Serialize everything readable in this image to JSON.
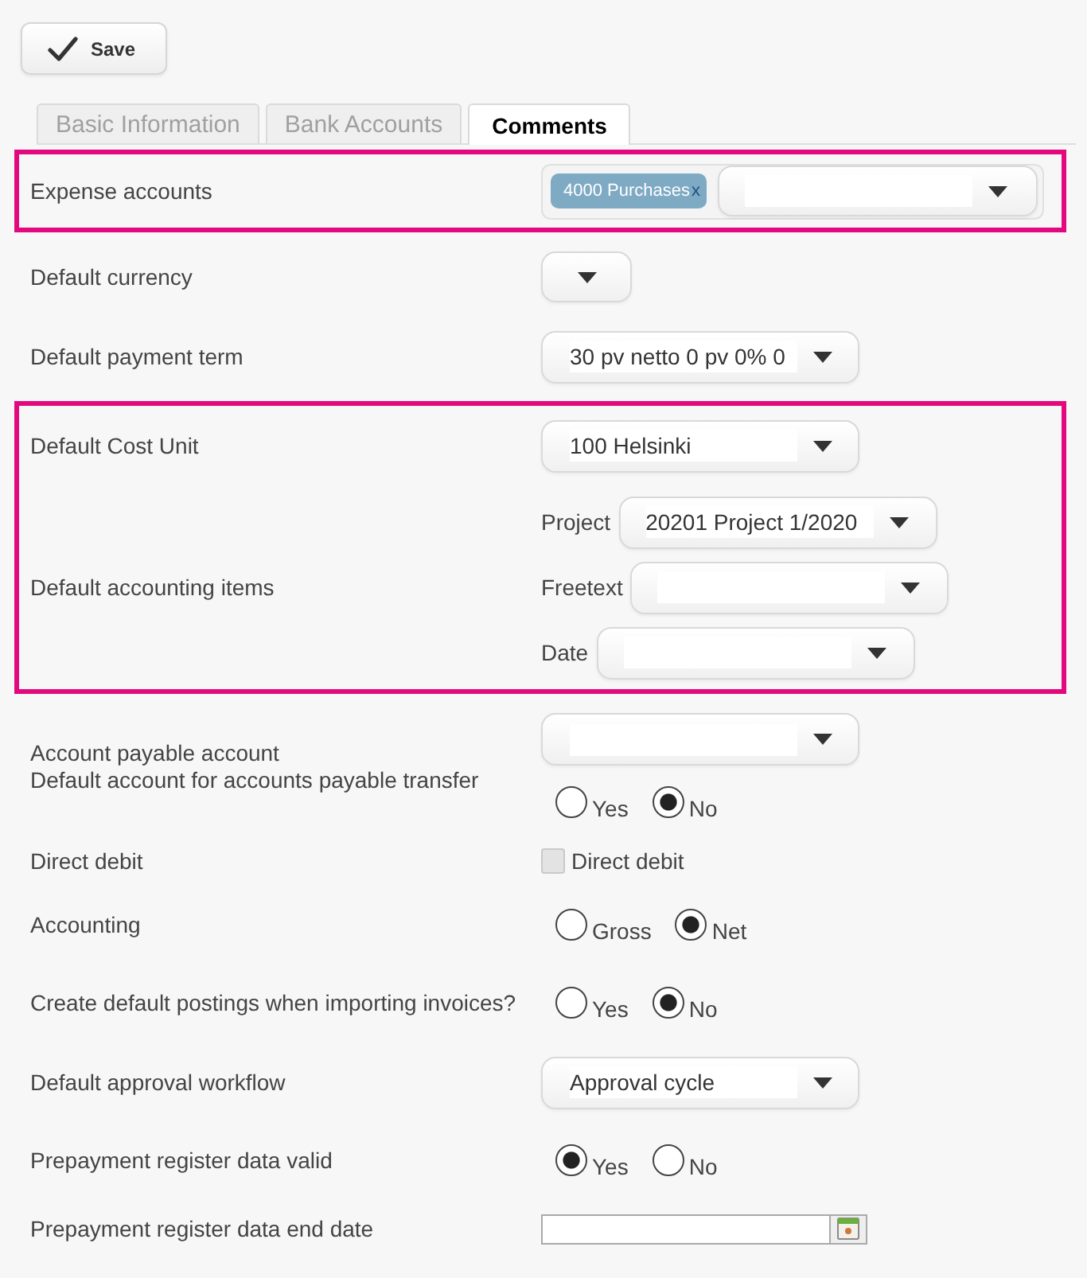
{
  "toolbar": {
    "save_button": {
      "label": "Save"
    }
  },
  "tabs": [
    {
      "label": "Basic Information",
      "selected": false
    },
    {
      "label": "Bank Accounts",
      "selected": false
    },
    {
      "label": "Comments",
      "selected": true
    }
  ],
  "groups": [
    {
      "highlighted": true,
      "fields": [
        {
          "kind": "tags-select",
          "label": "Expense accounts",
          "tags": [
            {
              "label": "4000 Purchases",
              "remove": "x"
            }
          ]
        }
      ]
    },
    {
      "highlighted": false,
      "fields": [
        {
          "kind": "short-select",
          "label": "Default currency"
        },
        {
          "kind": "select",
          "label": "Default payment term",
          "value": "30 pv netto 0 pv 0% 0"
        }
      ]
    },
    {
      "highlighted": true,
      "fields": [
        {
          "kind": "select",
          "label": "Default Cost Unit",
          "value": "100 Helsinki"
        },
        {
          "kind": "sub-selects",
          "label": "Default accounting items",
          "items": [
            {
              "label": "Project",
              "value": "20201 Project 1/2020"
            },
            {
              "label": "Freetext"
            },
            {
              "label": "Date"
            }
          ]
        }
      ]
    },
    {
      "highlighted": false,
      "fields": [
        {
          "kind": "select-radio",
          "labels": [
            "Account payable account",
            "Default account for accounts payable transfer"
          ],
          "options": [
            {
              "label": "Yes",
              "selected": false
            },
            {
              "label": "No",
              "selected": true
            }
          ]
        },
        {
          "kind": "checkbox",
          "label": "Direct debit",
          "checkbox": {
            "label": "Direct debit",
            "checked": false
          }
        },
        {
          "kind": "radio",
          "label": "Accounting",
          "options": [
            {
              "label": "Gross",
              "selected": false
            },
            {
              "label": "Net",
              "selected": true
            }
          ]
        },
        {
          "kind": "radio",
          "label": "Create default postings when importing invoices?",
          "options": [
            {
              "label": "Yes",
              "selected": false
            },
            {
              "label": "No",
              "selected": true
            }
          ]
        },
        {
          "kind": "select",
          "label": "Default approval workflow",
          "value": "Approval cycle"
        },
        {
          "kind": "radio",
          "label": "Prepayment register data valid",
          "options": [
            {
              "label": "Yes",
              "selected": true
            },
            {
              "label": "No",
              "selected": false
            }
          ]
        },
        {
          "kind": "date",
          "label": "Prepayment register data end date"
        }
      ]
    }
  ]
}
